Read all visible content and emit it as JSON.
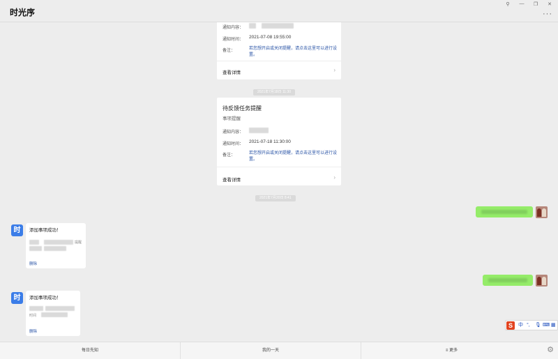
{
  "window": {
    "title": "时光序",
    "controls": [
      "pin-icon",
      "minimize-icon",
      "restore-icon",
      "close-icon"
    ],
    "more_glyph": "···"
  },
  "card1": {
    "notify_label": "通知内容：",
    "time_label": "通知时间：",
    "time_value": "2021-07-08 19:55:00",
    "remark_label": "备注：",
    "remark_text": "若您想开启或关闭提醒，请点击这里可以进行设置。",
    "detail_label": "查看详情"
  },
  "timestamp1": "2021年7月18日 11:30",
  "card2": {
    "title": "待反馈任务提醒",
    "subtitle": "事项提醒",
    "notify_label": "通知内容：",
    "time_label": "通知时间：",
    "time_value": "2021-07-18 11:30:00",
    "remark_label": "备注：",
    "remark_text": "若您想开启或关闭提醒，请点击这里可以进行设置。",
    "detail_label": "查看详情"
  },
  "timestamp2": "2021年7月20日 8:41",
  "bot_messages": [
    {
      "avatar_glyph": "时",
      "title": "添加事项成功！",
      "fragment": "提醒",
      "delete_label": "删除"
    },
    {
      "avatar_glyph": "时",
      "title": "添加事项成功！",
      "fragment": "时间",
      "delete_label": "删除"
    }
  ],
  "ime": {
    "logo": "S",
    "mode": "中",
    "punct": "°,",
    "tools": [
      "microphone-icon",
      "keyboard-icon",
      "grid-icon"
    ]
  },
  "bottom_menu": [
    {
      "label": "每日先知"
    },
    {
      "label": "我的一天"
    },
    {
      "label": "≡ 更多"
    }
  ],
  "colors": {
    "accent_blue": "#3b7de8",
    "link_blue": "#2a54a6",
    "bubble_green": "#95ec69",
    "ime_red": "#e2431f"
  }
}
